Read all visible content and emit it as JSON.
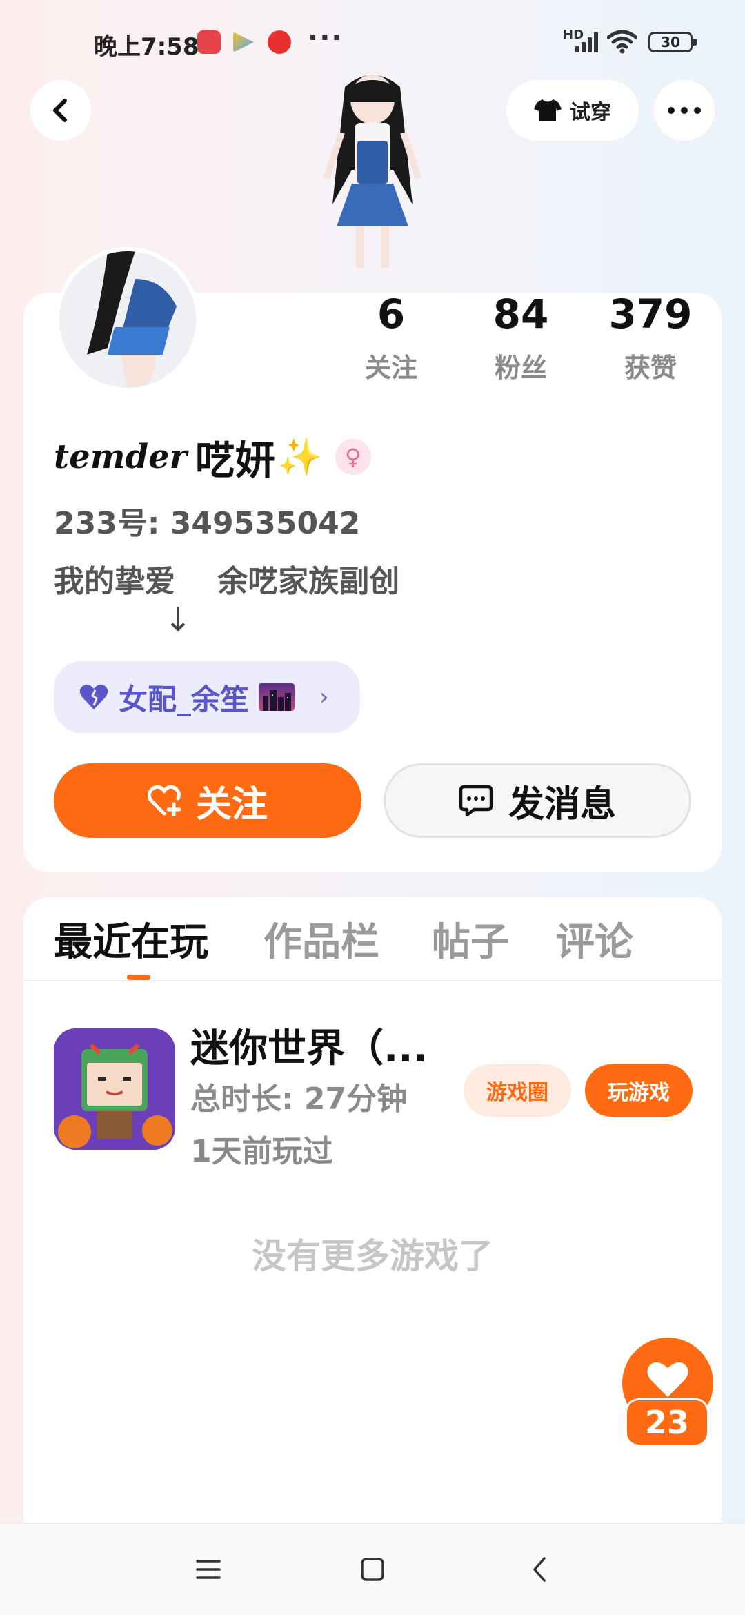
{
  "status_bar": {
    "time": "晚上7:58",
    "overflow": "···",
    "network_badge": "HD",
    "battery": "30"
  },
  "header": {
    "try_on_label": "试穿"
  },
  "profile": {
    "stats": [
      {
        "value": "6",
        "label": "关注"
      },
      {
        "value": "84",
        "label": "粉丝"
      },
      {
        "value": "379",
        "label": "获赞"
      }
    ],
    "name_script": "temder",
    "name_cn": "呓妍",
    "sparkle": "✨",
    "gender_symbol": "♀",
    "uid": "233号: 349535042",
    "bio": "我的挚爱    余呓家族副创",
    "bio_arrow": "↓",
    "relation_tag": "女配_余笙",
    "follow_label": "关注",
    "message_label": "发消息"
  },
  "tabs": [
    {
      "label": "最近在玩",
      "active": true
    },
    {
      "label": "作品栏",
      "active": false
    },
    {
      "label": "帖子",
      "active": false
    },
    {
      "label": "评论",
      "active": false
    }
  ],
  "games": [
    {
      "title": "迷你世界（...",
      "duration": "总时长: 27分钟",
      "last_played": "1天前玩过",
      "circle_label": "游戏圈",
      "play_label": "玩游戏"
    }
  ],
  "empty_hint": "没有更多游戏了",
  "like_count": "23",
  "colors": {
    "accent": "#ff6a13",
    "tag_bg": "#ececfc",
    "tag_text": "#5a55c8"
  }
}
